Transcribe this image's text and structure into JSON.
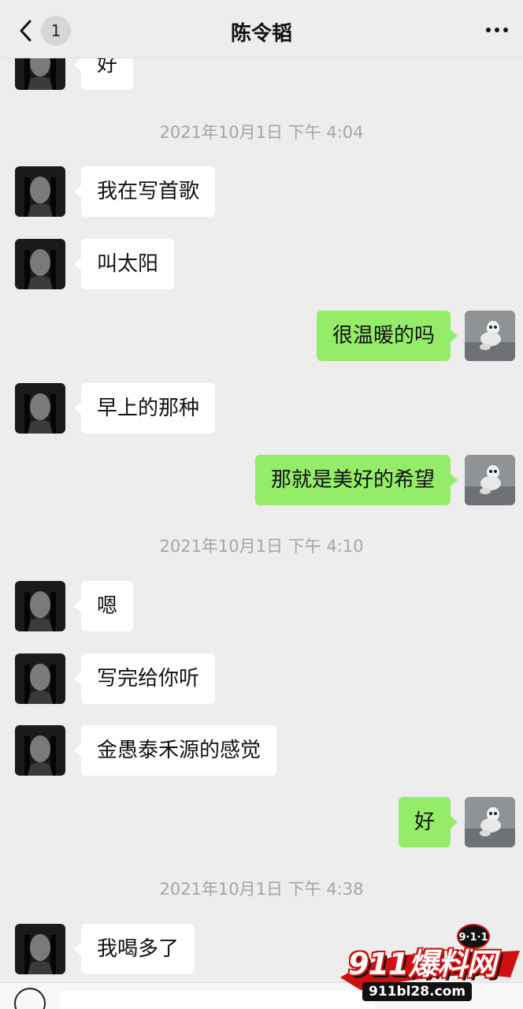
{
  "header": {
    "back_badge": "1",
    "title": "陈令韬"
  },
  "messages": [
    {
      "type": "msg",
      "side": "left",
      "text": "好"
    },
    {
      "type": "time",
      "text": "2021年10月1日 下午 4:04"
    },
    {
      "type": "msg",
      "side": "left",
      "text": "我在写首歌"
    },
    {
      "type": "msg",
      "side": "left",
      "text": "叫太阳"
    },
    {
      "type": "msg",
      "side": "right",
      "text": "很温暖的吗"
    },
    {
      "type": "msg",
      "side": "left",
      "text": "早上的那种"
    },
    {
      "type": "msg",
      "side": "right",
      "text": "那就是美好的希望"
    },
    {
      "type": "time",
      "text": "2021年10月1日 下午 4:10"
    },
    {
      "type": "msg",
      "side": "left",
      "text": "嗯"
    },
    {
      "type": "msg",
      "side": "left",
      "text": "写完给你听"
    },
    {
      "type": "msg",
      "side": "left",
      "text": "金愚泰禾源的感觉"
    },
    {
      "type": "msg",
      "side": "right",
      "text": "好"
    },
    {
      "type": "time",
      "text": "2021年10月1日 下午 4:38"
    },
    {
      "type": "msg",
      "side": "left",
      "text": "我喝多了"
    }
  ],
  "watermark": {
    "badge": "9·1·1",
    "main": "911爆料网",
    "url": "911bl28.com"
  },
  "colors": {
    "background": "#ededed",
    "bubble_left": "#ffffff",
    "bubble_right": "#95ec69",
    "timestamp": "#a5a5a5"
  }
}
